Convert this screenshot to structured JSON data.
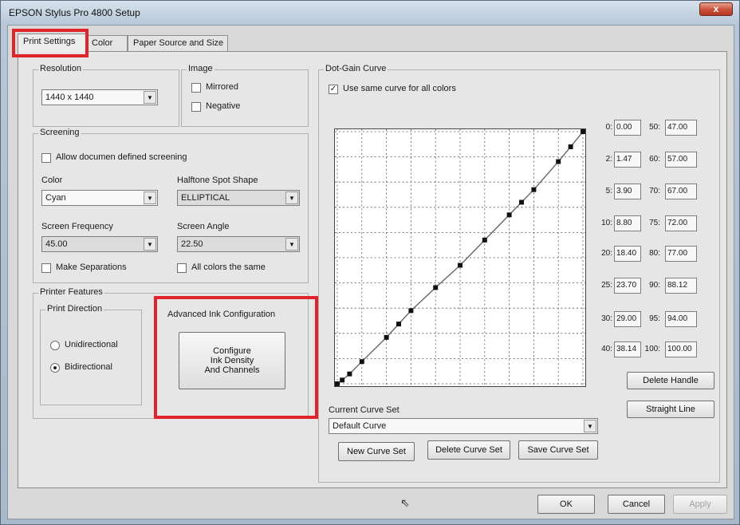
{
  "window": {
    "title": "EPSON Stylus Pro 4800 Setup",
    "close_glyph": "x"
  },
  "tabs": [
    {
      "label": "Print Settings",
      "active": true
    },
    {
      "label": "Color",
      "active": false
    },
    {
      "label": "Paper Source and Size",
      "active": false
    }
  ],
  "resolution": {
    "legend": "Resolution",
    "value": "1440 x 1440"
  },
  "image": {
    "legend": "Image",
    "mirrored": "Mirrored",
    "negative": "Negative"
  },
  "screening": {
    "legend": "Screening",
    "allow_label": "Allow documen defined screening",
    "color_label": "Color",
    "color_value": "Cyan",
    "halftone_label": "Halftone Spot Shape",
    "halftone_value": "ELLIPTICAL",
    "frequency_label": "Screen Frequency",
    "frequency_value": "45.00",
    "angle_label": "Screen Angle",
    "angle_value": "22.50",
    "make_sep_label": "Make Separations",
    "all_colors_label": "All colors the same"
  },
  "printer_features": {
    "legend": "Printer Features",
    "direction_legend": "Print Direction",
    "unidirectional": "Unidirectional",
    "bidirectional": "Bidirectional",
    "adv_legend": "Advanced Ink Configuration",
    "configure_line1": "Configure",
    "configure_line2": "Ink Density",
    "configure_line3": "And Channels"
  },
  "dot_gain": {
    "legend": "Dot-Gain Curve",
    "use_same_label": "Use same curve for all colors",
    "use_same_checked": "✓",
    "left_column": [
      {
        "label": "0:",
        "value": "0.00"
      },
      {
        "label": "2:",
        "value": "1.47"
      },
      {
        "label": "5:",
        "value": "3.90"
      },
      {
        "label": "10:",
        "value": "8.80"
      },
      {
        "label": "20:",
        "value": "18.40"
      },
      {
        "label": "25:",
        "value": "23.70"
      },
      {
        "label": "30:",
        "value": "29.00"
      },
      {
        "label": "40:",
        "value": "38.14"
      }
    ],
    "right_column": [
      {
        "label": "50:",
        "value": "47.00"
      },
      {
        "label": "60:",
        "value": "57.00"
      },
      {
        "label": "70:",
        "value": "67.00"
      },
      {
        "label": "75:",
        "value": "72.00"
      },
      {
        "label": "80:",
        "value": "77.00"
      },
      {
        "label": "90:",
        "value": "88.12"
      },
      {
        "label": "95:",
        "value": "94.00"
      },
      {
        "label": "100:",
        "value": "100.00"
      }
    ],
    "delete_handle": "Delete Handle",
    "straight_line": "Straight Line",
    "current_set_label": "Current Curve Set",
    "current_set_value": "Default Curve",
    "new_set": "New Curve Set",
    "delete_set": "Delete Curve Set",
    "save_set": "Save Curve Set"
  },
  "chart_data": {
    "type": "line",
    "xlim": [
      0,
      100
    ],
    "ylim": [
      0,
      100
    ],
    "grid": true,
    "x": [
      0,
      2,
      5,
      10,
      20,
      25,
      30,
      40,
      50,
      60,
      70,
      75,
      80,
      90,
      95,
      100
    ],
    "y": [
      0,
      1.47,
      3.9,
      8.8,
      18.4,
      23.7,
      29,
      38.14,
      47,
      57,
      67,
      72,
      77,
      88.12,
      94,
      100
    ]
  },
  "footer": {
    "ok": "OK",
    "cancel": "Cancel",
    "apply": "Apply"
  },
  "colors": {
    "highlight": "#e0242c"
  }
}
